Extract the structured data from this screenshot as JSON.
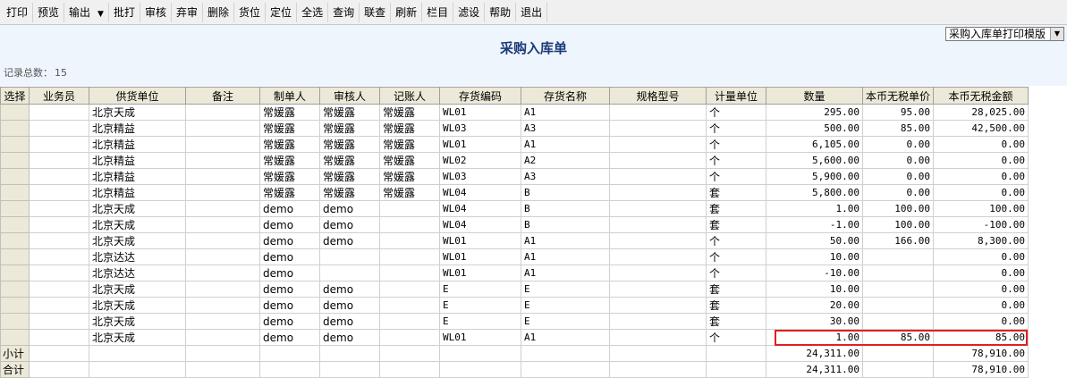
{
  "toolbar": {
    "buttons": [
      "打印",
      "预览",
      "输出",
      "批打",
      "审核",
      "弃审",
      "删除",
      "货位",
      "定位",
      "全选",
      "查询",
      "联查",
      "刷新",
      "栏目",
      "滤设",
      "帮助",
      "退出"
    ],
    "output_arrow": "▼"
  },
  "title": "采购入库单",
  "template": {
    "selected": "采购入库单打印模版"
  },
  "record_count": {
    "label": "记录总数：",
    "value": "15"
  },
  "columns": [
    "选择",
    "业务员",
    "供货单位",
    "备注",
    "制单人",
    "审核人",
    "记账人",
    "存货编码",
    "存货名称",
    "规格型号",
    "计量单位",
    "数量",
    "本币无税单价",
    "本币无税金额"
  ],
  "rows": [
    [
      "",
      "",
      "北京天成",
      "",
      "常媛露",
      "常媛露",
      "常媛露",
      "WL01",
      "A1",
      "",
      "个",
      "295.00",
      "95.00",
      "28,025.00"
    ],
    [
      "",
      "",
      "北京精益",
      "",
      "常媛露",
      "常媛露",
      "常媛露",
      "WL03",
      "A3",
      "",
      "个",
      "500.00",
      "85.00",
      "42,500.00"
    ],
    [
      "",
      "",
      "北京精益",
      "",
      "常媛露",
      "常媛露",
      "常媛露",
      "WL01",
      "A1",
      "",
      "个",
      "6,105.00",
      "0.00",
      "0.00"
    ],
    [
      "",
      "",
      "北京精益",
      "",
      "常媛露",
      "常媛露",
      "常媛露",
      "WL02",
      "A2",
      "",
      "个",
      "5,600.00",
      "0.00",
      "0.00"
    ],
    [
      "",
      "",
      "北京精益",
      "",
      "常媛露",
      "常媛露",
      "常媛露",
      "WL03",
      "A3",
      "",
      "个",
      "5,900.00",
      "0.00",
      "0.00"
    ],
    [
      "",
      "",
      "北京精益",
      "",
      "常媛露",
      "常媛露",
      "常媛露",
      "WL04",
      "B",
      "",
      "套",
      "5,800.00",
      "0.00",
      "0.00"
    ],
    [
      "",
      "",
      "北京天成",
      "",
      "demo",
      "demo",
      "",
      "WL04",
      "B",
      "",
      "套",
      "1.00",
      "100.00",
      "100.00"
    ],
    [
      "",
      "",
      "北京天成",
      "",
      "demo",
      "demo",
      "",
      "WL04",
      "B",
      "",
      "套",
      "-1.00",
      "100.00",
      "-100.00"
    ],
    [
      "",
      "",
      "北京天成",
      "",
      "demo",
      "demo",
      "",
      "WL01",
      "A1",
      "",
      "个",
      "50.00",
      "166.00",
      "8,300.00"
    ],
    [
      "",
      "",
      "北京达达",
      "",
      "demo",
      "",
      "",
      "WL01",
      "A1",
      "",
      "个",
      "10.00",
      "",
      "0.00"
    ],
    [
      "",
      "",
      "北京达达",
      "",
      "demo",
      "",
      "",
      "WL01",
      "A1",
      "",
      "个",
      "-10.00",
      "",
      "0.00"
    ],
    [
      "",
      "",
      "北京天成",
      "",
      "demo",
      "demo",
      "",
      "E",
      "E",
      "",
      "套",
      "10.00",
      "",
      "0.00"
    ],
    [
      "",
      "",
      "北京天成",
      "",
      "demo",
      "demo",
      "",
      "E",
      "E",
      "",
      "套",
      "20.00",
      "",
      "0.00"
    ],
    [
      "",
      "",
      "北京天成",
      "",
      "demo",
      "demo",
      "",
      "E",
      "E",
      "",
      "套",
      "30.00",
      "",
      "0.00"
    ],
    [
      "",
      "",
      "北京天成",
      "",
      "demo",
      "demo",
      "",
      "WL01",
      "A1",
      "",
      "个",
      "1.00",
      "85.00",
      "85.00"
    ]
  ],
  "subtotal": {
    "label": "小计",
    "quantity": "24,311.00",
    "amount": "78,910.00"
  },
  "total": {
    "label": "合计",
    "quantity": "24,311.00",
    "amount": "78,910.00"
  },
  "colors": {
    "header_bg": "#eef5fd",
    "title": "#1a3a78",
    "highlight": "#e02020"
  }
}
